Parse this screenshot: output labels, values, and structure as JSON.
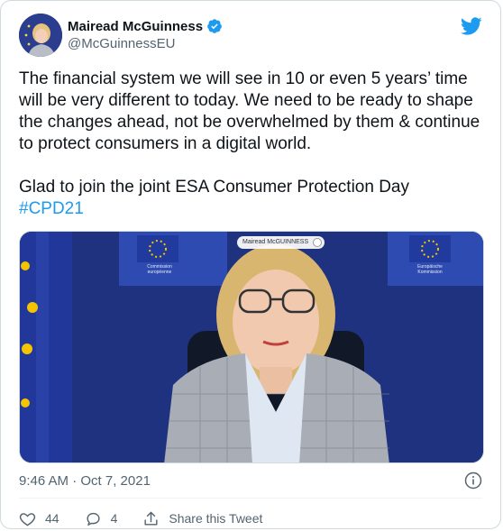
{
  "author": {
    "name": "Mairead McGuinness",
    "handle": "@McGuinnessEU",
    "verified": true
  },
  "tweet": {
    "paragraph1": "The financial system we will see in 10 or even 5 years’ time will be very different to today. We need to be ready to shape the changes ahead, not be overwhelmed by them & continue to protect consumers in a digital world.",
    "paragraph2": "Glad to join the joint ESA Consumer Protection Day",
    "hashtag": "#CPD21",
    "timestamp": "9:46 AM · Oct 7, 2021"
  },
  "media": {
    "participant_label": "Mairead McGUINNESS",
    "banner_left": "Commission européenne",
    "banner_right": "Europäische Kommission"
  },
  "actions": {
    "likes": "44",
    "replies": "4",
    "share_label": "Share this Tweet"
  },
  "colors": {
    "accent": "#1d9bf0",
    "text": "#0f1419",
    "muted": "#536471",
    "eu_blue": "#1f3796"
  },
  "icons": [
    "twitter-bird-icon",
    "verified-badge-icon",
    "info-icon",
    "like-icon",
    "reply-icon",
    "share-icon"
  ]
}
